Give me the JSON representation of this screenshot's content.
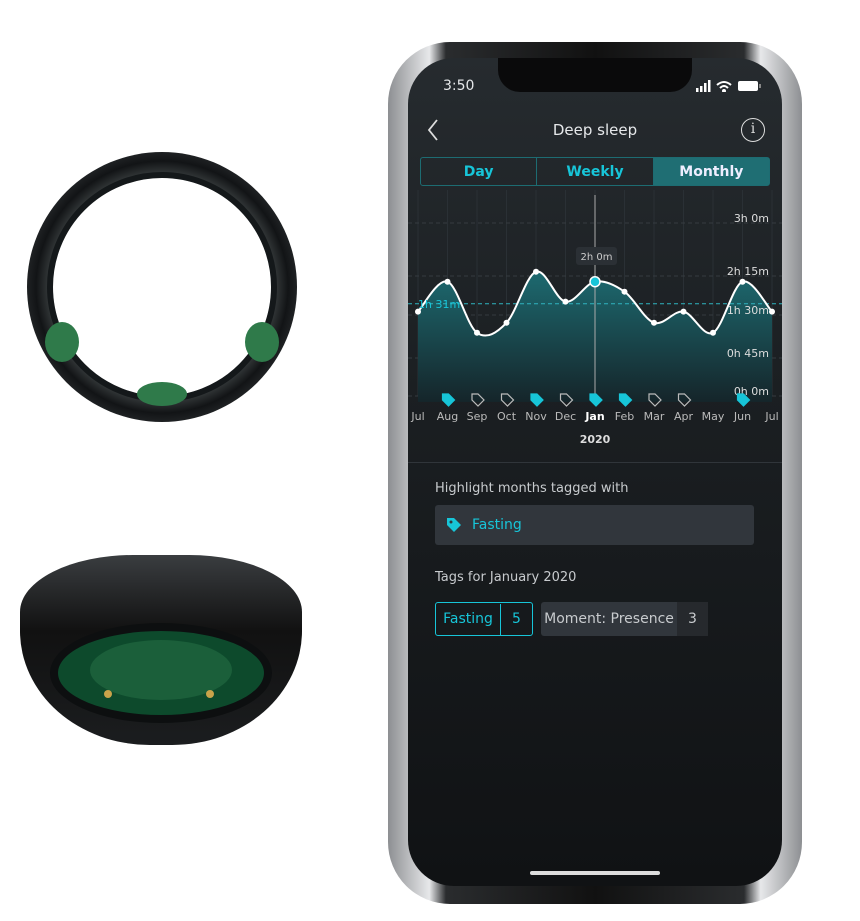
{
  "status_bar": {
    "time": "3:50"
  },
  "header": {
    "title": "Deep sleep",
    "back_icon": "chevron-left-icon",
    "info_icon": "info-icon"
  },
  "tabs": [
    {
      "label": "Day",
      "selected": false
    },
    {
      "label": "Weekly",
      "selected": false
    },
    {
      "label": "Monthly",
      "selected": true
    }
  ],
  "chart_data": {
    "type": "area",
    "categories": [
      "Jul",
      "Aug",
      "Sep",
      "Oct",
      "Nov",
      "Dec",
      "Jan",
      "Feb",
      "Mar",
      "Apr",
      "May",
      "Jun",
      "Jul"
    ],
    "values_minutes": [
      93,
      120,
      74,
      83,
      129,
      102,
      120,
      111,
      83,
      93,
      74,
      120,
      93
    ],
    "tagged": [
      false,
      true,
      false,
      false,
      true,
      false,
      true,
      true,
      false,
      false,
      false,
      true,
      false
    ],
    "has_tag_icon": [
      false,
      true,
      true,
      true,
      true,
      true,
      true,
      true,
      true,
      true,
      false,
      true,
      false
    ],
    "y_ticks": [
      "3h 0m",
      "2h 15m",
      "1h 30m",
      "0h 45m",
      "0h 0m"
    ],
    "average_label": "1h 31m",
    "selected_label": "2h 0m",
    "selected_index": 6,
    "x_year_label": "2020",
    "colors": {
      "line": "#ffffff",
      "fill": "#1d6a70",
      "accent": "#17c5d8"
    }
  },
  "highlight": {
    "label": "Highlight months tagged with",
    "tag": "Fasting"
  },
  "tags_section": {
    "label": "Tags for January 2020",
    "tags": [
      {
        "name": "Fasting",
        "count": "5",
        "active": true
      },
      {
        "name": "Moment: Presence",
        "count": "3",
        "active": false
      }
    ]
  }
}
